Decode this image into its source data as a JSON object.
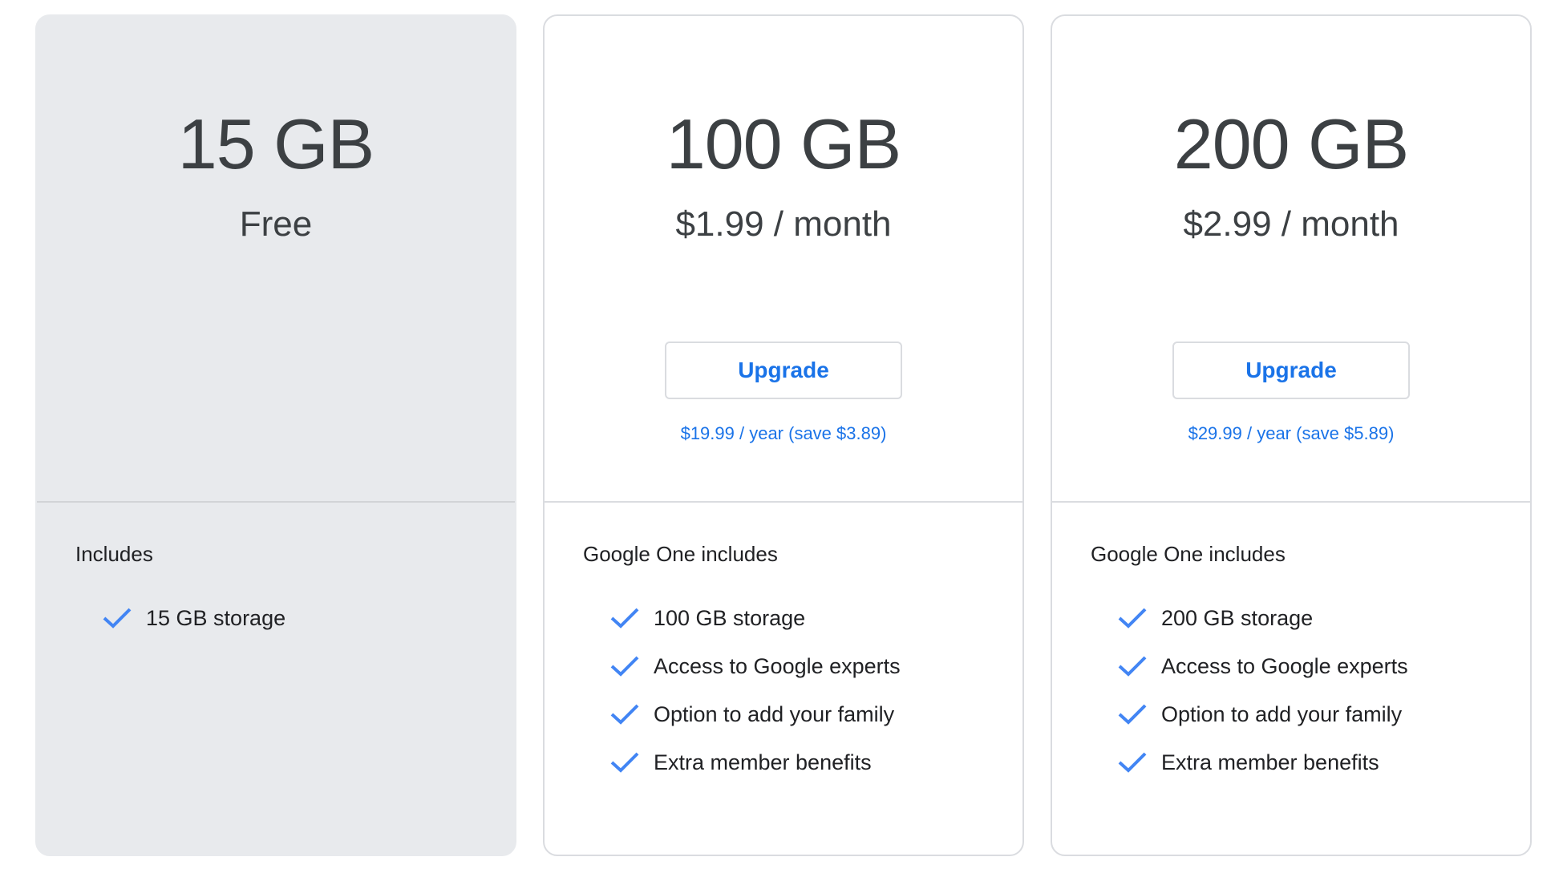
{
  "plans": [
    {
      "storage": "15 GB",
      "price": "Free",
      "includes_title": "Includes",
      "features": [
        "15 GB storage"
      ]
    },
    {
      "storage": "100 GB",
      "price": "$1.99 / month",
      "upgrade_label": "Upgrade",
      "annual_offer": "$19.99 / year (save $3.89)",
      "includes_title": "Google One includes",
      "features": [
        "100 GB storage",
        "Access to Google experts",
        "Option to add your family",
        "Extra member benefits"
      ]
    },
    {
      "storage": "200 GB",
      "price": "$2.99 / month",
      "upgrade_label": "Upgrade",
      "annual_offer": "$29.99 / year (save $5.89)",
      "includes_title": "Google One includes",
      "features": [
        "200 GB storage",
        "Access to Google experts",
        "Option to add your family",
        "Extra member benefits"
      ]
    }
  ],
  "icons": {
    "feature_check": "check-icon"
  },
  "colors": {
    "accent": "#1a73e8",
    "check": "#4285f4",
    "current_plan_bg": "#e8eaed",
    "border": "#dadce0",
    "text": "#3c4043"
  }
}
